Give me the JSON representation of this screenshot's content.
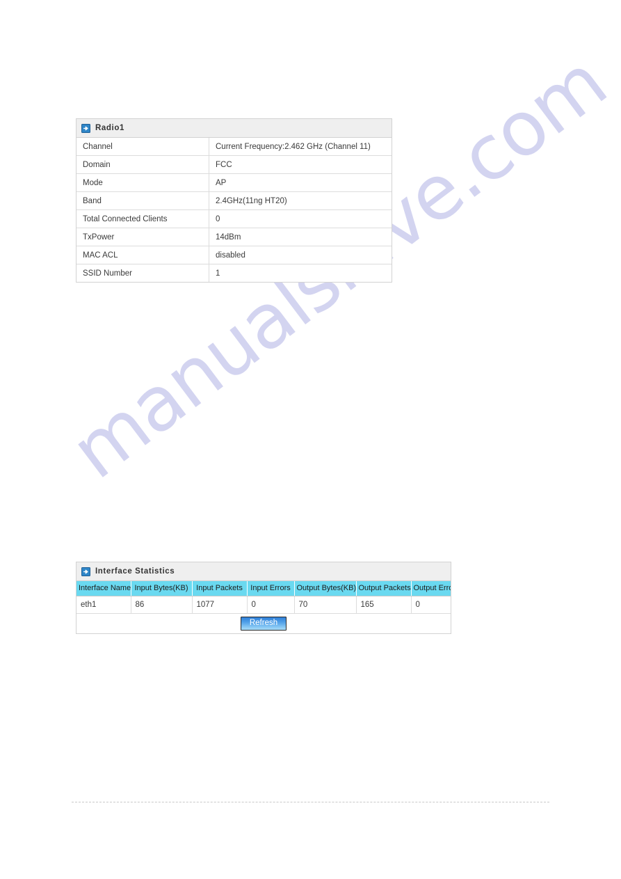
{
  "watermark": {
    "text": "manualshive.com"
  },
  "radio_panel": {
    "icon": "blue-arrow-icon",
    "title": "Radio1",
    "rows": [
      {
        "label": "Channel",
        "value": "Current Frequency:2.462 GHz (Channel 11)"
      },
      {
        "label": "Domain",
        "value": "FCC"
      },
      {
        "label": "Mode",
        "value": "AP"
      },
      {
        "label": "Band",
        "value": "2.4GHz(11ng HT20)"
      },
      {
        "label": "Total Connected Clients",
        "value": "0"
      },
      {
        "label": "TxPower",
        "value": "14dBm"
      },
      {
        "label": "MAC ACL",
        "value": "disabled"
      },
      {
        "label": "SSID Number",
        "value": "1"
      }
    ]
  },
  "interface_statistics": {
    "icon": "blue-arrow-icon",
    "title": "Interface Statistics",
    "columns": [
      "Interface Name",
      "Input Bytes(KB)",
      "Input Packets",
      "Input Errors",
      "Output Bytes(KB)",
      "Output Packets",
      "Output Errors"
    ],
    "rows": [
      {
        "interface_name": "eth1",
        "input_bytes_kb": "86",
        "input_packets": "1077",
        "input_errors": "0",
        "output_bytes_kb": "70",
        "output_packets": "165",
        "output_errors": "0"
      }
    ],
    "refresh_label": "Refresh"
  },
  "colors": {
    "table_header_cyan": "#6ad9f0",
    "panel_header_gray": "#efefef",
    "button_blue": "#2f7fd8",
    "watermark_lavender": "#b9bbe8",
    "border_gray": "#dcdcdc"
  }
}
